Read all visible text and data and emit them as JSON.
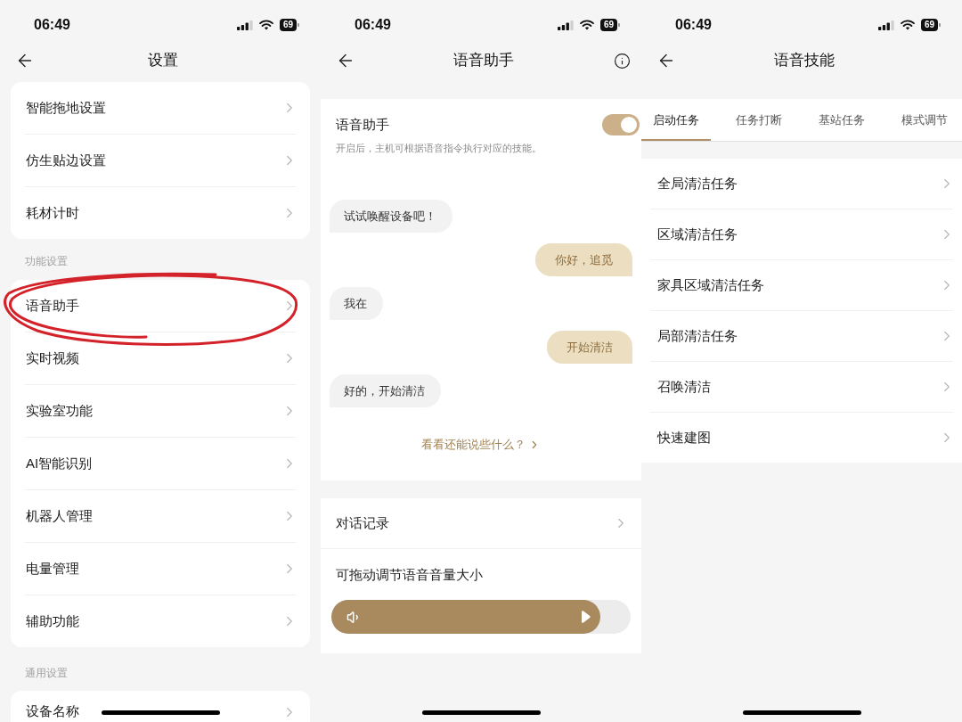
{
  "settings_screen": {
    "status_bar": {
      "time": "06:49",
      "battery": "69"
    },
    "title": "设置",
    "groups": [
      {
        "items": [
          {
            "label": "智能拖地设置",
            "circled": false
          },
          {
            "label": "仿生贴边设置",
            "circled": false
          },
          {
            "label": "耗材计时",
            "circled": false
          }
        ]
      },
      {
        "heading": "功能设置",
        "items": [
          {
            "label": "语音助手",
            "circled": true
          },
          {
            "label": "实时视频",
            "circled": false
          },
          {
            "label": "实验室功能",
            "circled": false
          },
          {
            "label": "AI智能识别",
            "circled": false
          },
          {
            "label": "机器人管理",
            "circled": false
          },
          {
            "label": "电量管理",
            "circled": false
          },
          {
            "label": "辅助功能",
            "circled": false
          }
        ]
      },
      {
        "heading": "通用设置",
        "items": [
          {
            "label": "设备名称",
            "circled": false
          }
        ]
      }
    ]
  },
  "voice_assistant_screen": {
    "status_bar": {
      "time": "06:49",
      "battery": "69"
    },
    "title": "语音助手",
    "switch": {
      "label": "语音助手",
      "description": "开启后，主机可根据语音指令执行对应的技能。",
      "on": true
    },
    "chat": [
      {
        "kind": "device",
        "text": "试试唤醒设备吧！"
      },
      {
        "kind": "user",
        "text": "你好，追觅"
      },
      {
        "kind": "device",
        "text": "我在"
      },
      {
        "kind": "user",
        "text": "开始清洁"
      },
      {
        "kind": "device",
        "text": "好的，开始清洁"
      }
    ],
    "more_link": "看看还能说些什么？",
    "history": {
      "label": "对话记录"
    },
    "volume": {
      "label": "可拖动调节语音音量大小",
      "level": 0.9
    }
  },
  "voice_skills_screen": {
    "status_bar": {
      "time": "06:49",
      "battery": "69"
    },
    "title": "语音技能",
    "tabs": [
      {
        "label": "启动任务",
        "selected": true
      },
      {
        "label": "任务打断",
        "selected": false
      },
      {
        "label": "基站任务",
        "selected": false
      },
      {
        "label": "模式调节",
        "selected": false
      }
    ],
    "items": [
      "全局清洁任务",
      "区域清洁任务",
      "家具区域清洁任务",
      "局部清洁任务",
      "召唤清洁",
      "快速建图"
    ]
  }
}
